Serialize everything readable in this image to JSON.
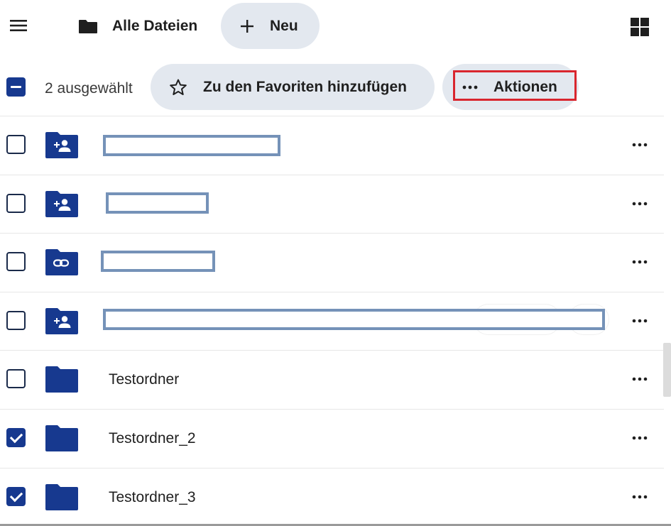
{
  "header": {
    "breadcrumb_label": "Alle Dateien",
    "new_button_label": "Neu",
    "icons": {
      "menu": "hamburger-menu-icon",
      "breadcrumb": "folder-icon",
      "new": "plus-icon",
      "view": "grid-view-icon"
    }
  },
  "selection_bar": {
    "count_label": "2 ausgewählt",
    "favorite_button_label": "Zu den Favoriten hinzufügen",
    "actions_button_label": "Aktionen"
  },
  "files": [
    {
      "kind": "shared-folder",
      "icon": "shared-folder-icon",
      "name": "",
      "redacted": true,
      "checked": false
    },
    {
      "kind": "shared-folder",
      "icon": "shared-folder-icon",
      "name": "",
      "redacted": true,
      "checked": false
    },
    {
      "kind": "link-folder",
      "icon": "link-folder-icon",
      "name": "",
      "redacted": true,
      "checked": false
    },
    {
      "kind": "shared-folder",
      "icon": "shared-folder-icon",
      "name": "",
      "redacted": true,
      "checked": false
    },
    {
      "kind": "folder",
      "icon": "folder-icon",
      "name": "Testordner",
      "redacted": false,
      "checked": false
    },
    {
      "kind": "folder",
      "icon": "folder-icon",
      "name": "Testordner_2",
      "redacted": false,
      "checked": true
    },
    {
      "kind": "folder",
      "icon": "folder-icon",
      "name": "Testordner_3",
      "redacted": false,
      "checked": true
    }
  ],
  "colors": {
    "accent": "#17398f",
    "chip_background": "#e3e8ef",
    "highlight": "#d9262e",
    "redaction_border": "#7592b8"
  }
}
